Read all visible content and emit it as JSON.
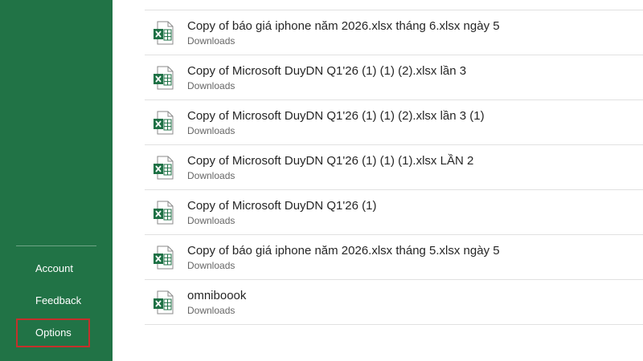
{
  "sidebar": {
    "items": [
      {
        "label": "Account"
      },
      {
        "label": "Feedback"
      },
      {
        "label": "Options"
      }
    ],
    "highlight_color": "#c4302b",
    "background": "#217346"
  },
  "recent_files": [
    {
      "name": "Copy of báo giá iphone năm 2026.xlsx tháng 6.xlsx ngày 5",
      "location": "Downloads",
      "icon": "excel-file-icon"
    },
    {
      "name": "Copy of Microsoft DuyDN Q1'26 (1) (1) (2).xlsx lần 3",
      "location": "Downloads",
      "icon": "excel-file-icon"
    },
    {
      "name": "Copy of Microsoft DuyDN Q1'26 (1) (1) (2).xlsx lần 3 (1)",
      "location": "Downloads",
      "icon": "excel-file-icon"
    },
    {
      "name": "Copy of Microsoft DuyDN Q1'26 (1) (1) (1).xlsx LẦN 2",
      "location": "Downloads",
      "icon": "excel-file-icon"
    },
    {
      "name": "Copy of Microsoft DuyDN Q1'26 (1)",
      "location": "Downloads",
      "icon": "excel-file-icon"
    },
    {
      "name": "Copy of báo giá iphone năm 2026.xlsx tháng 5.xlsx ngày 5",
      "location": "Downloads",
      "icon": "excel-file-icon"
    },
    {
      "name": "omniboook",
      "location": "Downloads",
      "icon": "excel-file-icon"
    }
  ]
}
